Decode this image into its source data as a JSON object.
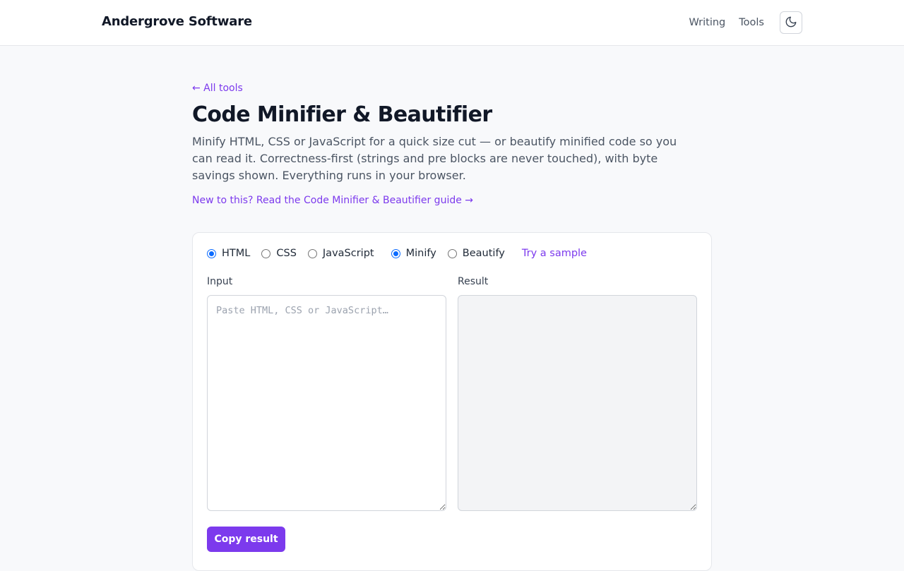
{
  "header": {
    "brand": "Andergrove Software",
    "nav": [
      "Writing",
      "Tools"
    ],
    "theme_icon": "moon-icon"
  },
  "page": {
    "back_link": "← All tools",
    "title": "Code Minifier & Beautifier",
    "description": "Minify HTML, CSS or JavaScript for a quick size cut — or beautify minified code so you can read it. Correctness-first (strings and pre blocks are never touched), with byte savings shown. Everything runs in your browser.",
    "guide_link": "New to this? Read the Code Minifier & Beautifier guide →"
  },
  "tool": {
    "languages": [
      {
        "label": "HTML",
        "selected": true
      },
      {
        "label": "CSS",
        "selected": false
      },
      {
        "label": "JavaScript",
        "selected": false
      }
    ],
    "modes": [
      {
        "label": "Minify",
        "selected": true
      },
      {
        "label": "Beautify",
        "selected": false
      }
    ],
    "sample_link": "Try a sample",
    "input_label": "Input",
    "input_placeholder": "Paste HTML, CSS or JavaScript…",
    "input_value": "",
    "result_label": "Result",
    "result_value": "",
    "copy_button": "Copy result"
  },
  "colors": {
    "accent": "#7c3aed",
    "radio_selected": "#0b6bff"
  }
}
